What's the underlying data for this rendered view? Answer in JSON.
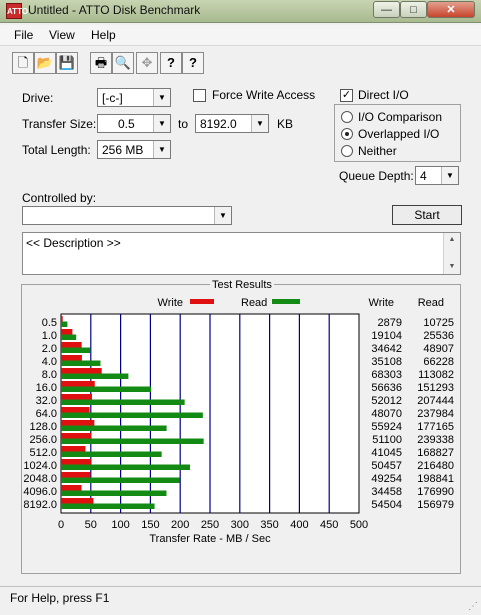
{
  "window": {
    "title": "Untitled - ATTO Disk Benchmark",
    "app_icon": "atto-app-icon"
  },
  "caption_buttons": {
    "minimize": "—",
    "maximize": "□",
    "close": "✕"
  },
  "menu": [
    "File",
    "View",
    "Help"
  ],
  "toolbar": [
    {
      "name": "new-document-icon",
      "glyph": "🗋"
    },
    {
      "name": "open-folder-icon",
      "glyph": "📂"
    },
    {
      "name": "save-icon",
      "glyph": "💾"
    },
    {
      "name": "print-icon",
      "glyph": "🖶"
    },
    {
      "name": "print-preview-icon",
      "glyph": "🔍"
    },
    {
      "name": "move-icon",
      "glyph": "✥"
    },
    {
      "name": "help-icon",
      "glyph": "?"
    },
    {
      "name": "context-help-icon",
      "glyph": "?"
    }
  ],
  "form": {
    "drive_label": "Drive:",
    "drive_value": "[-c-]",
    "transfer_size_label": "Transfer Size:",
    "transfer_from": "0.5",
    "to_label": "to",
    "transfer_to": "8192.0",
    "kb_label": "KB",
    "total_length_label": "Total Length:",
    "total_length_value": "256 MB",
    "force_write_label": "Force Write Access",
    "force_write_checked": false,
    "direct_io_label": "Direct I/O",
    "direct_io_checked": true,
    "io_comparison_label": "I/O Comparison",
    "overlapped_io_label": "Overlapped I/O",
    "neither_label": "Neither",
    "selected_mode": "overlapped",
    "queue_depth_label": "Queue Depth:",
    "queue_depth_value": "4",
    "controlled_by_label": "Controlled by:",
    "controlled_by_value": "",
    "start_label": "Start",
    "description_text": "<< Description >>"
  },
  "results": {
    "title": "Test Results",
    "write_legend": "Write",
    "read_legend": "Read",
    "write_header": "Write",
    "read_header": "Read"
  },
  "chart_data": {
    "type": "bar",
    "orientation": "horizontal",
    "title": "Test Results",
    "xlabel": "Transfer Rate - MB / Sec",
    "xlim": [
      0,
      500
    ],
    "xticks": [
      0,
      50,
      100,
      150,
      200,
      250,
      300,
      350,
      400,
      450,
      500
    ],
    "categories": [
      "0.5",
      "1.0",
      "2.0",
      "4.0",
      "8.0",
      "16.0",
      "32.0",
      "64.0",
      "128.0",
      "256.0",
      "512.0",
      "1024.0",
      "2048.0",
      "4096.0",
      "8192.0"
    ],
    "series": [
      {
        "name": "Write",
        "color": "#e01010",
        "values": [
          2.879,
          19.104,
          34.642,
          35.108,
          68.303,
          56.636,
          52.012,
          48.07,
          55.924,
          51.1,
          41.045,
          50.457,
          49.254,
          34.458,
          54.504
        ]
      },
      {
        "name": "Read",
        "color": "#138a13",
        "values": [
          10.725,
          25.536,
          48.907,
          66.228,
          113.082,
          151.293,
          207.444,
          237.984,
          177.165,
          239.338,
          168.827,
          216.48,
          198.841,
          176.99,
          156.979
        ]
      }
    ],
    "write_values_text": [
      "2879",
      "19104",
      "34642",
      "35108",
      "68303",
      "56636",
      "52012",
      "48070",
      "55924",
      "51100",
      "41045",
      "50457",
      "49254",
      "34458",
      "54504"
    ],
    "read_values_text": [
      "10725",
      "25536",
      "48907",
      "66228",
      "113082",
      "151293",
      "207444",
      "237984",
      "177165",
      "239338",
      "168827",
      "216480",
      "198841",
      "176990",
      "156979"
    ],
    "colors": {
      "write": "#e01010",
      "read": "#138a13",
      "gridline": "#00008b"
    }
  },
  "status": {
    "text": "For Help, press F1"
  }
}
